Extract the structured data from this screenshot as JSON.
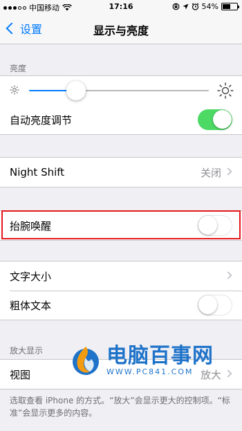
{
  "status_bar": {
    "carrier": "中国移动",
    "time": "17:16",
    "battery": "54%",
    "battery_level": 0.54
  },
  "nav": {
    "back_label": "设置",
    "title": "显示与亮度"
  },
  "brightness": {
    "header": "亮度",
    "slider_value": 0.26,
    "auto_label": "自动亮度调节",
    "auto_on": true
  },
  "night_shift": {
    "label": "Night Shift",
    "value": "关闭"
  },
  "raise_to_wake": {
    "label": "抬腕唤醒",
    "on": false
  },
  "text": {
    "size_label": "文字大小",
    "bold_label": "粗体文本",
    "bold_on": false
  },
  "zoom": {
    "header": "放大显示",
    "view_label": "视图",
    "view_value": "放大",
    "footer": "选取查看 iPhone 的方式。“放大”会显示更大的控制项。“标准”会显示更多的内容。"
  },
  "watermark": {
    "title": "电脑百事网",
    "url": "WWW.PC841.COM"
  },
  "colors": {
    "accent": "#007aff",
    "toggle_on": "#4cd964",
    "highlight": "#e4161b"
  }
}
